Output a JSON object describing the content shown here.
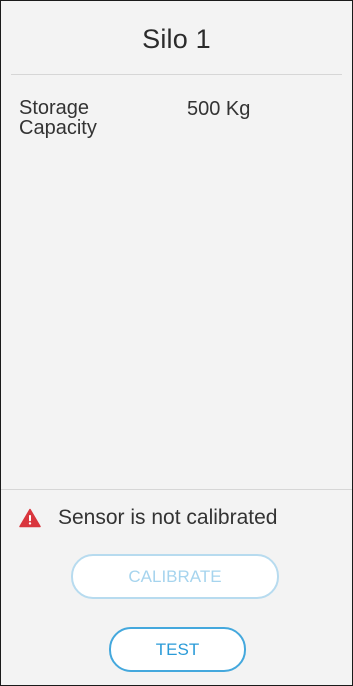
{
  "header": {
    "title": "Silo 1"
  },
  "details": {
    "storage_capacity_label": "Storage Capacity",
    "storage_capacity_value": "500 Kg"
  },
  "status": {
    "icon": "warning-triangle-icon",
    "message": "Sensor is not calibrated",
    "color": "#d9363e"
  },
  "actions": {
    "calibrate_label": "CALIBRATE",
    "calibrate_disabled": true,
    "test_label": "TEST"
  },
  "colors": {
    "accent": "#2a9bd8",
    "accent_disabled": "#a6d4ee",
    "panel_background": "#f3f3f3",
    "warning": "#d9363e"
  }
}
